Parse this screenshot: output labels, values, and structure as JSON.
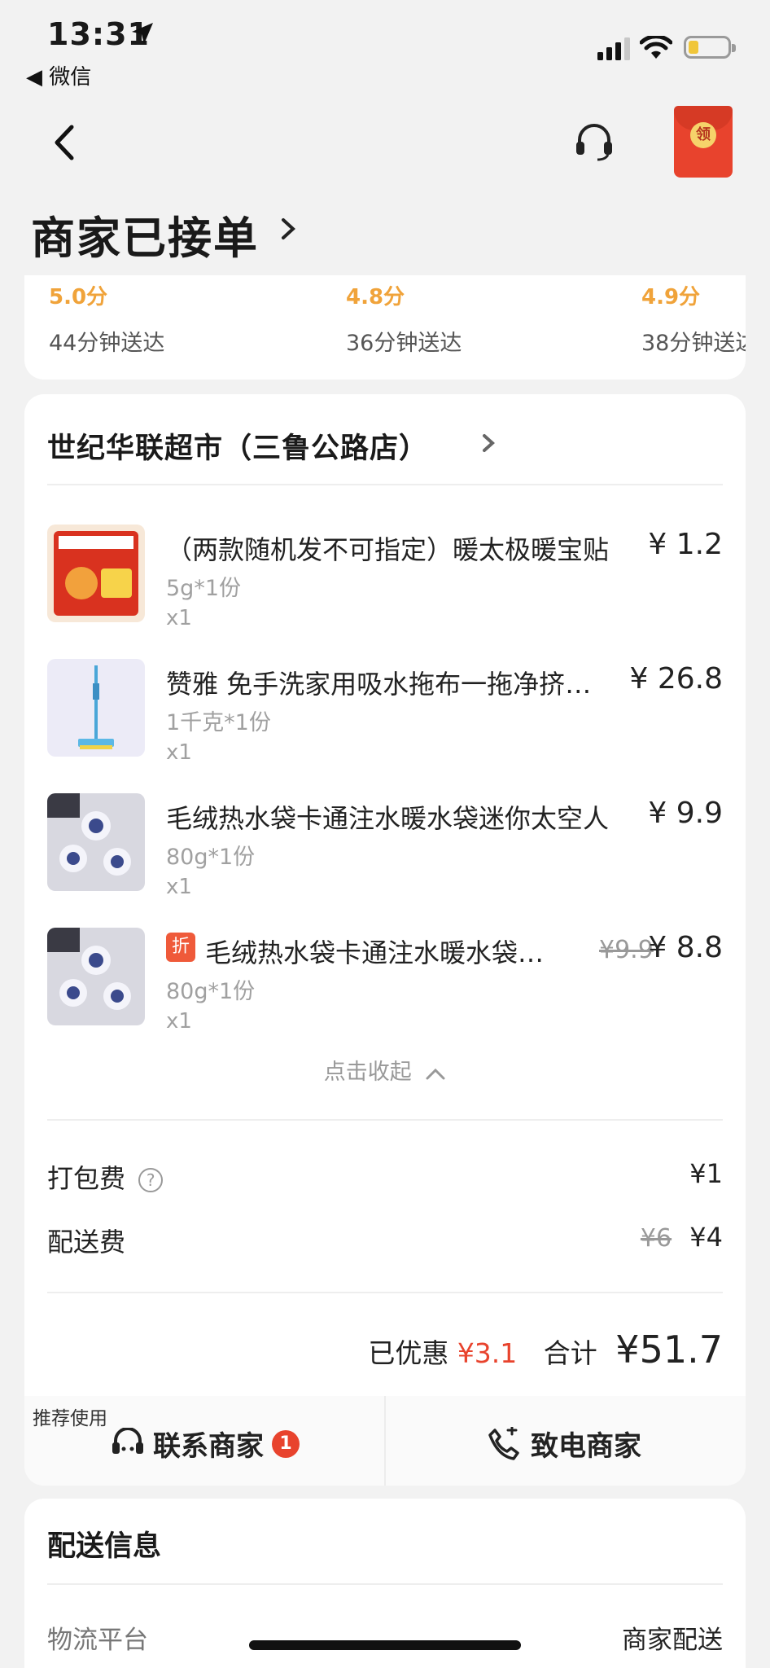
{
  "status_bar": {
    "time": "13:31",
    "back_app": "◀ 微信"
  },
  "header": {
    "title": "商家已接单",
    "redpacket_label": "领"
  },
  "recommended_stores": [
    {
      "score": "5.0分",
      "eta": "44分钟送达"
    },
    {
      "score": "4.8分",
      "eta": "36分钟送达"
    },
    {
      "score": "4.9分",
      "eta": "38分钟送达"
    }
  ],
  "order": {
    "store_name": "世纪华联超市（三鲁公路店）",
    "items": [
      {
        "name": "（两款随机发不可指定）暖太极暖宝贴",
        "spec": "5g*1份",
        "qty": "x1",
        "price": "¥ 1.2"
      },
      {
        "name": "赞雅 免手洗家用吸水拖布一拖净挤水拖把",
        "spec": "1千克*1份",
        "qty": "x1",
        "price": "¥ 26.8"
      },
      {
        "name": "毛绒热水袋卡通注水暖水袋迷你太空人",
        "spec": "80g*1份",
        "qty": "x1",
        "price": "¥ 9.9"
      },
      {
        "name": "毛绒热水袋卡通注水暖水袋迷你太空人",
        "spec": "80g*1份",
        "qty": "x1",
        "price": "¥ 8.8",
        "original_price": "¥9.9",
        "tag": "折"
      }
    ],
    "collapse_label": "点击收起",
    "packing_fee_label": "打包费",
    "packing_fee": "¥1",
    "delivery_fee_label": "配送费",
    "delivery_fee_original": "¥6",
    "delivery_fee": "¥4",
    "discount_label": "已优惠",
    "discount_value": "¥3.1",
    "total_label": "合计",
    "total_value": "¥51.7"
  },
  "actions": {
    "recommend_tag": "推荐使用",
    "contact_label": "联系商家",
    "contact_badge": "1",
    "call_label": "致电商家"
  },
  "delivery": {
    "title": "配送信息",
    "platform_label": "物流平台",
    "platform_value": "商家配送"
  },
  "colors": {
    "accent_red": "#e8432d",
    "score_orange": "#f0a33a"
  },
  "icons": [
    "location-arrow-icon",
    "signal-icon",
    "wifi-icon",
    "battery-icon",
    "back-chevron-icon",
    "headset-icon",
    "red-packet-icon",
    "chevron-right-icon",
    "chevron-up-icon",
    "help-icon",
    "chat-icon",
    "phone-icon"
  ]
}
